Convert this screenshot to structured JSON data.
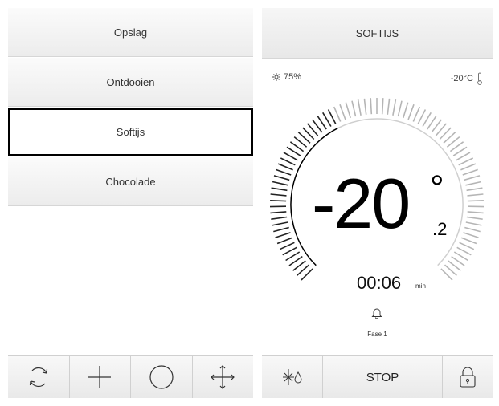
{
  "menu": {
    "items": [
      {
        "label": "Opslag",
        "selected": false
      },
      {
        "label": "Ontdooien",
        "selected": false
      },
      {
        "label": "Softijs",
        "selected": true
      },
      {
        "label": "Chocolade",
        "selected": false
      }
    ]
  },
  "left_toolbar": {
    "icons": [
      "refresh-icon",
      "plus-icon",
      "circle-icon",
      "move-icon"
    ]
  },
  "program": {
    "title": "SOFTIJS",
    "humidity": "75%",
    "humidity_icon": "humidity-icon",
    "setpoint": "-20°C",
    "thermometer_icon": "thermometer-icon",
    "temperature_main": "-20",
    "degree_symbol": "°",
    "temperature_decimal": ".2",
    "time": "00:06",
    "time_unit": "min",
    "phase": "Fase 1",
    "progress_fraction": 0.4
  },
  "right_toolbar": {
    "mode_icon": "freeze-defrost-icon",
    "stop_label": "STOP",
    "lock_icon": "lock-icon"
  }
}
